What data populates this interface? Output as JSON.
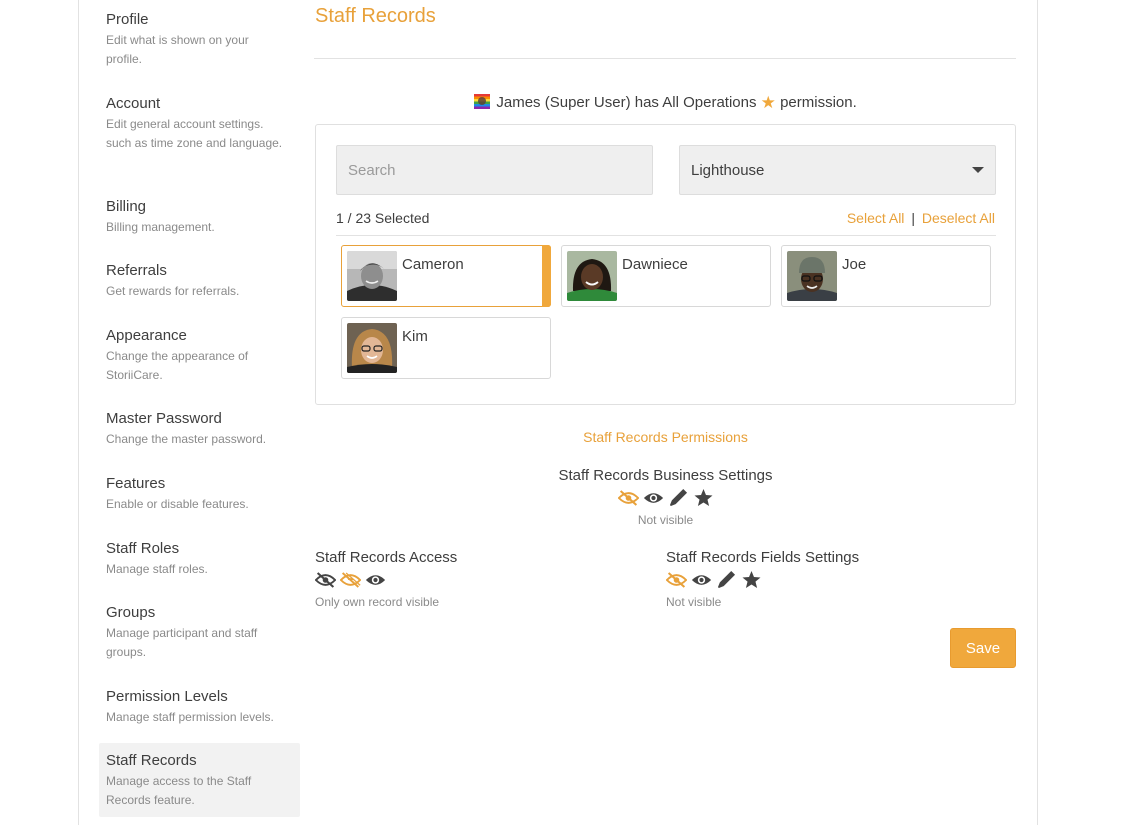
{
  "sidebar": {
    "items": [
      {
        "title": "Profile",
        "desc": "Edit what is shown on your profile."
      },
      {
        "title": "Account",
        "desc": "Edit general account settings. such as time zone and language."
      },
      {
        "title": "Billing",
        "desc": "Billing management."
      },
      {
        "title": "Referrals",
        "desc": "Get rewards for referrals."
      },
      {
        "title": "Appearance",
        "desc": "Change the appearance of StoriiCare."
      },
      {
        "title": "Master Password",
        "desc": "Change the master password."
      },
      {
        "title": "Features",
        "desc": "Enable or disable features."
      },
      {
        "title": "Staff Roles",
        "desc": "Manage staff roles."
      },
      {
        "title": "Groups",
        "desc": "Manage participant and staff groups."
      },
      {
        "title": "Permission Levels",
        "desc": "Manage staff permission levels."
      },
      {
        "title": "Staff Records",
        "desc": "Manage access to the Staff Records feature."
      }
    ]
  },
  "main": {
    "title": "Staff Records",
    "notice_before": "James (Super User) has All Operations",
    "notice_after": "permission.",
    "search_placeholder": "Search",
    "location_value": "Lighthouse",
    "selected_count": "1 / 23 Selected",
    "select_all": "Select All",
    "separator": "|",
    "deselect_all": "Deselect All",
    "staff": [
      {
        "name": "Cameron",
        "selected": true
      },
      {
        "name": "Dawniece",
        "selected": false
      },
      {
        "name": "Joe",
        "selected": false
      },
      {
        "name": "Kim",
        "selected": false
      }
    ]
  },
  "permissions": {
    "heading": "Staff Records Permissions",
    "business": {
      "title": "Staff Records Business Settings",
      "status": "Not visible"
    },
    "access": {
      "title": "Staff Records Access",
      "status": "Only own record visible"
    },
    "fields": {
      "title": "Staff Records Fields Settings",
      "status": "Not visible"
    }
  },
  "save_label": "Save",
  "colors": {
    "accent": "#e8a13a",
    "icon_dark": "#444444"
  }
}
